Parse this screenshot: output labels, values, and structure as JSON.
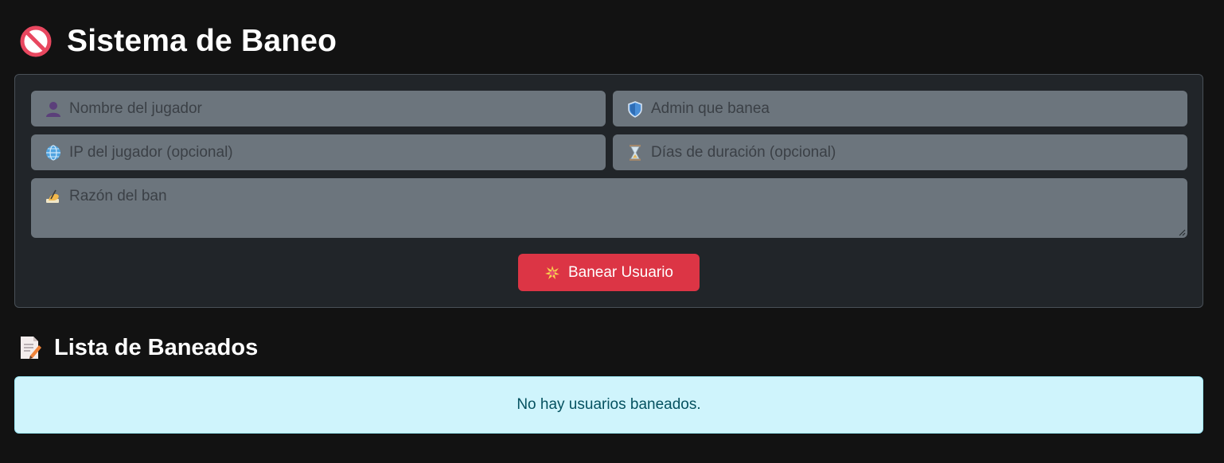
{
  "header": {
    "title": "Sistema de Baneo",
    "icon": "prohibited-icon"
  },
  "form": {
    "nombre_placeholder": "Nombre del jugador",
    "admin_placeholder": "Admin que banea",
    "ip_placeholder": "IP del jugador (opcional)",
    "dias_placeholder": "Días de duración (opcional)",
    "razon_placeholder": "Razón del ban",
    "submit_label": "Banear Usuario",
    "icons": {
      "nombre": "user-silhouette-icon",
      "admin": "shield-icon",
      "ip": "globe-icon",
      "dias": "hourglass-icon",
      "razon": "writing-hand-icon",
      "submit": "collision-icon"
    }
  },
  "list": {
    "title": "Lista de Baneados",
    "icon": "memo-icon",
    "empty_message": "No hay usuarios baneados."
  },
  "colors": {
    "background": "#121212",
    "card": "#212529",
    "input": "#6c757d",
    "danger": "#dc3545",
    "info_bg": "#cff4fc",
    "info_text": "#055160"
  }
}
